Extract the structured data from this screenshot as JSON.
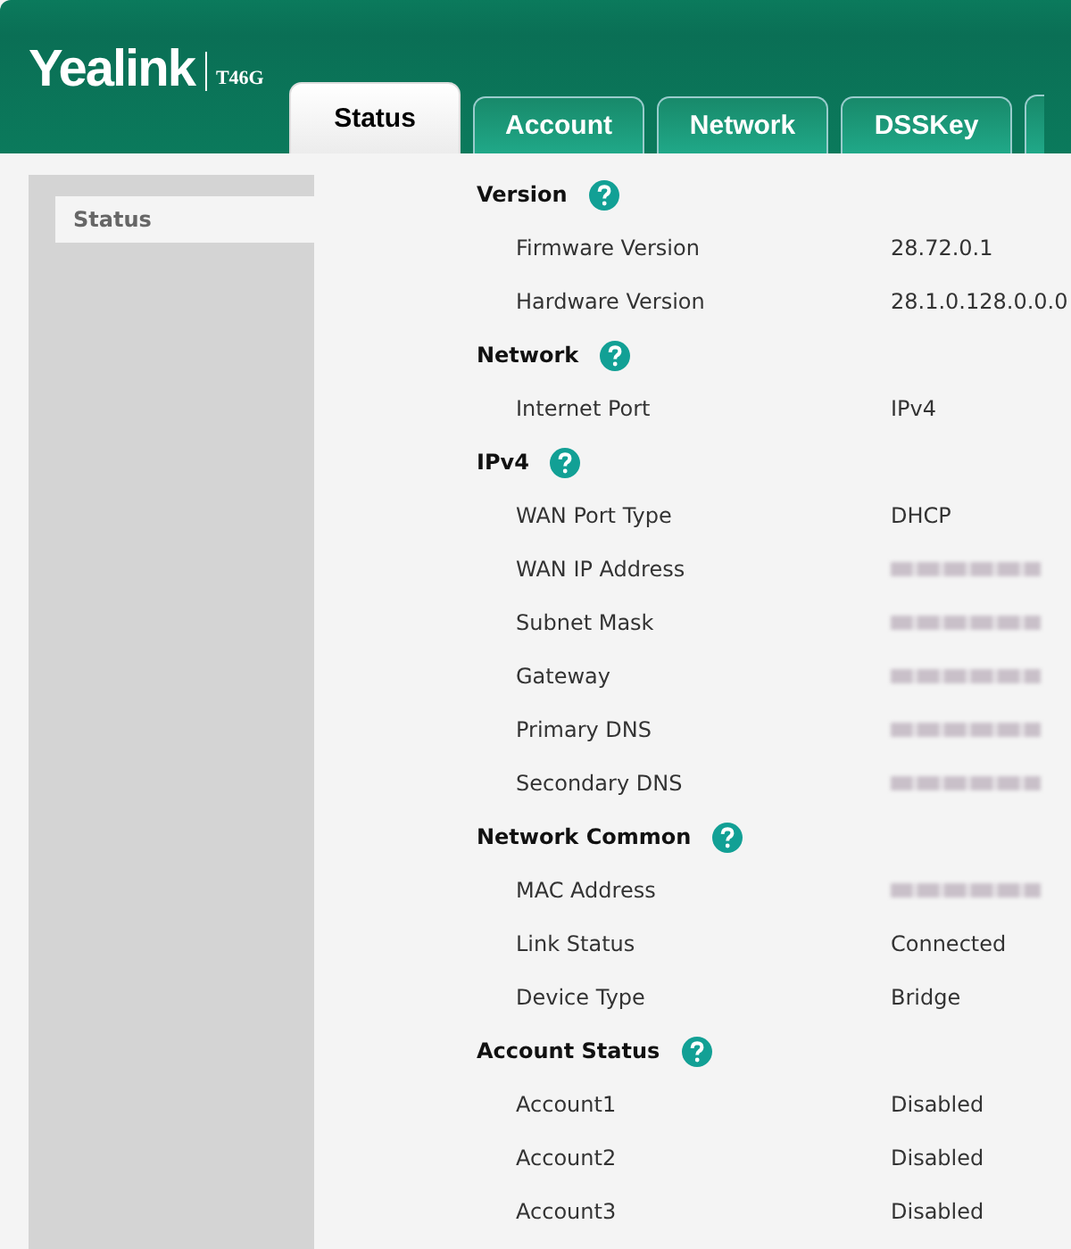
{
  "header": {
    "brand": "Yealink",
    "model": "T46G"
  },
  "tabs": [
    {
      "label": "Status",
      "selected": true
    },
    {
      "label": "Account",
      "selected": false
    },
    {
      "label": "Network",
      "selected": false
    },
    {
      "label": "DSSKey",
      "selected": false
    }
  ],
  "sidebar": {
    "items": [
      {
        "label": "Status",
        "selected": true
      }
    ]
  },
  "sections": [
    {
      "title": "Version",
      "rows": [
        {
          "label": "Firmware Version",
          "value": "28.72.0.1",
          "kind": "text"
        },
        {
          "label": "Hardware Version",
          "value": "28.1.0.128.0.0.0",
          "kind": "text"
        }
      ]
    },
    {
      "title": "Network",
      "rows": [
        {
          "label": "Internet Port",
          "value": "IPv4",
          "kind": "text"
        }
      ]
    },
    {
      "title": "IPv4",
      "rows": [
        {
          "label": "WAN Port Type",
          "value": "DHCP",
          "kind": "text"
        },
        {
          "label": "WAN IP Address",
          "kind": "blurred"
        },
        {
          "label": "Subnet Mask",
          "kind": "blurred"
        },
        {
          "label": "Gateway",
          "kind": "blurred"
        },
        {
          "label": "Primary DNS",
          "kind": "blurred"
        },
        {
          "label": "Secondary DNS",
          "kind": "blurred"
        }
      ]
    },
    {
      "title": "Network Common",
      "rows": [
        {
          "label": "MAC Address",
          "kind": "blurred"
        },
        {
          "label": "Link Status",
          "value": "Connected",
          "kind": "text"
        },
        {
          "label": "Device Type",
          "value": "Bridge",
          "kind": "text"
        }
      ]
    },
    {
      "title": "Account Status",
      "rows": [
        {
          "label": "Account1",
          "value": "Disabled",
          "kind": "text"
        },
        {
          "label": "Account2",
          "value": "Disabled",
          "kind": "text"
        },
        {
          "label": "Account3",
          "value": "Disabled",
          "kind": "text"
        }
      ]
    }
  ]
}
